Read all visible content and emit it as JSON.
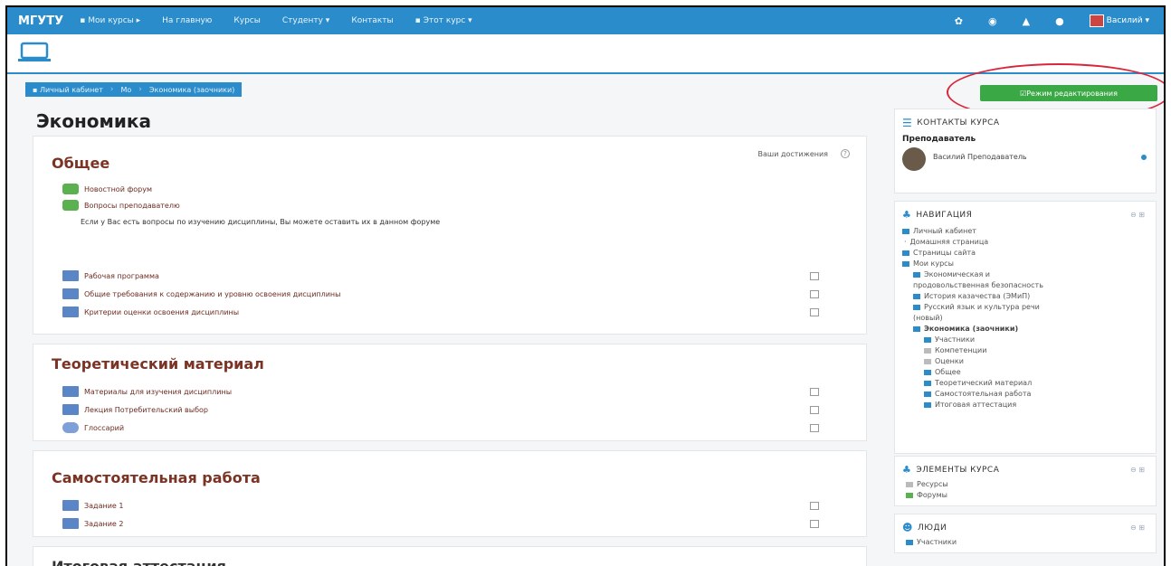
{
  "navbar": {
    "brand": "МГУТУ",
    "items": [
      "Мои курсы ▸",
      "На главную",
      "Курсы",
      "Студенту ▾",
      "Контакты",
      "Этот курс ▾"
    ],
    "user_name": "Василий ▾"
  },
  "breadcrumb": [
    "Личный кабинет",
    "Мо",
    "Экономика (заочники)"
  ],
  "edit_button": "Режим редактирования",
  "page_title": "Экономика",
  "achievements": "Ваши достижения",
  "sections": {
    "general": {
      "title": "Общее",
      "forum1": "Новостной форум",
      "forum2": "Вопросы преподавателю",
      "description": "Если у Вас есть вопросы по изучению дисциплины, Вы можете оставить их в данном форуме",
      "items": [
        "Рабочая программа",
        "Общие требования к содержанию и уровню освоения дисциплины",
        "Критерии оценки освоения дисциплины"
      ]
    },
    "theory": {
      "title": "Теоретический материал",
      "items": [
        "Материалы для изучения дисциплины",
        "Лекция Потребительский выбор",
        "Глоссарий"
      ]
    },
    "selfwork": {
      "title": "Самостоятельная работа",
      "items": [
        "Задание 1",
        "Задание 2"
      ]
    },
    "final": {
      "title": "Итоговая аттестация"
    }
  },
  "sidebar": {
    "contacts": {
      "title": "КОНТАКТЫ КУРСА",
      "role": "Преподаватель",
      "teacher": "Василий Преподаватель"
    },
    "navigation": {
      "title": "НАВИГАЦИЯ",
      "items": [
        "Личный кабинет",
        "Домашняя страница",
        "Страницы сайта",
        "Мои курсы",
        "Экономическая и",
        "продовольственная безопасность",
        "История казачества (ЭМиП)",
        "Русский язык и культура речи",
        "(новый)",
        "Экономика (заочники)",
        "Участники",
        "Компетенции",
        "Оценки",
        "Общее",
        "Теоретический материал",
        "Самостоятельная работа",
        "Итоговая аттестация"
      ]
    },
    "elements": {
      "title": "ЭЛЕМЕНТЫ КУРСА",
      "items": [
        "Ресурсы",
        "Форумы"
      ]
    },
    "people": {
      "title": "ЛЮДИ",
      "items": [
        "Участники"
      ]
    }
  }
}
